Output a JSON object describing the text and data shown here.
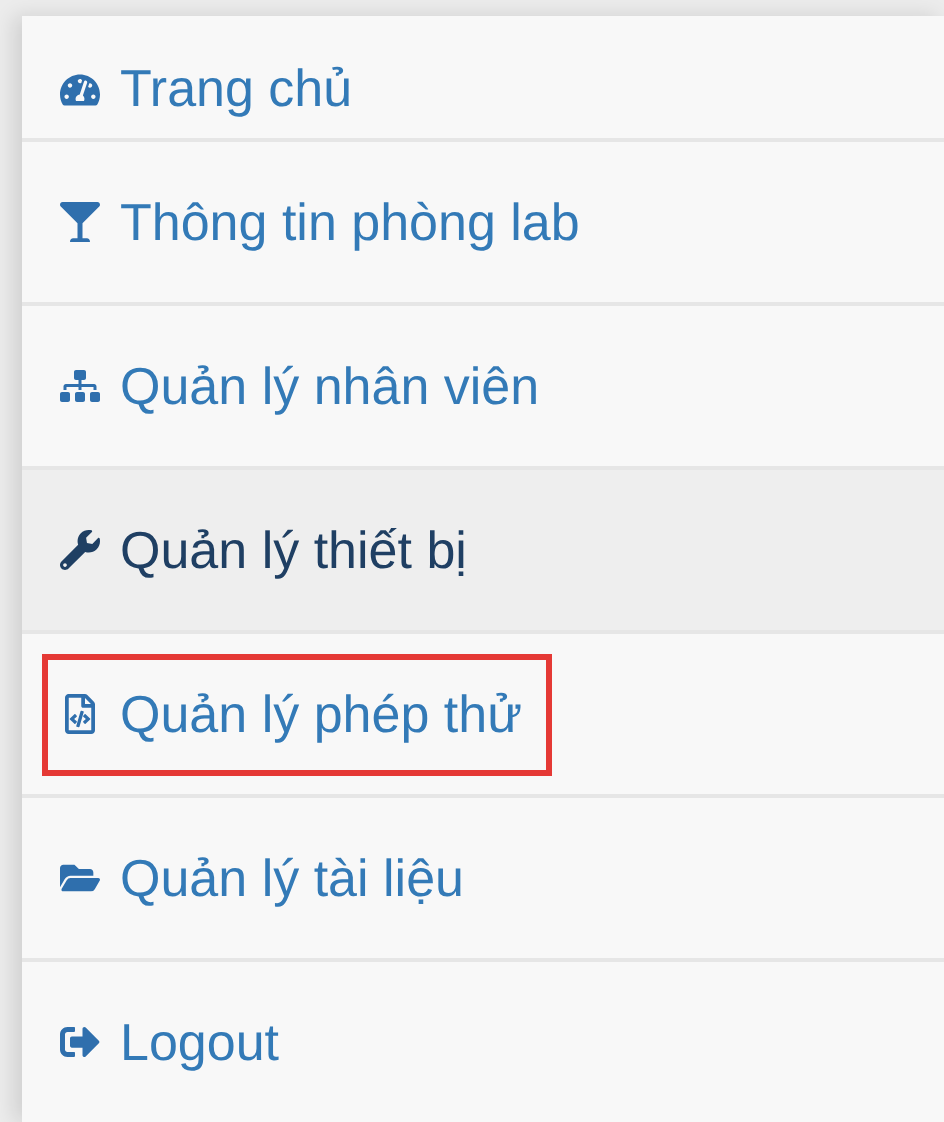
{
  "menu": [
    {
      "label": "Trang chủ",
      "selected": false,
      "highlighted": false
    },
    {
      "label": "Thông tin phòng lab",
      "selected": false,
      "highlighted": false
    },
    {
      "label": "Quản lý nhân viên",
      "selected": false,
      "highlighted": false
    },
    {
      "label": "Quản lý thiết bị",
      "selected": true,
      "highlighted": false
    },
    {
      "label": "Quản lý phép thử",
      "selected": false,
      "highlighted": true
    },
    {
      "label": "Quản lý tài liệu",
      "selected": false,
      "highlighted": false
    },
    {
      "label": "Logout",
      "selected": false,
      "highlighted": false
    }
  ]
}
